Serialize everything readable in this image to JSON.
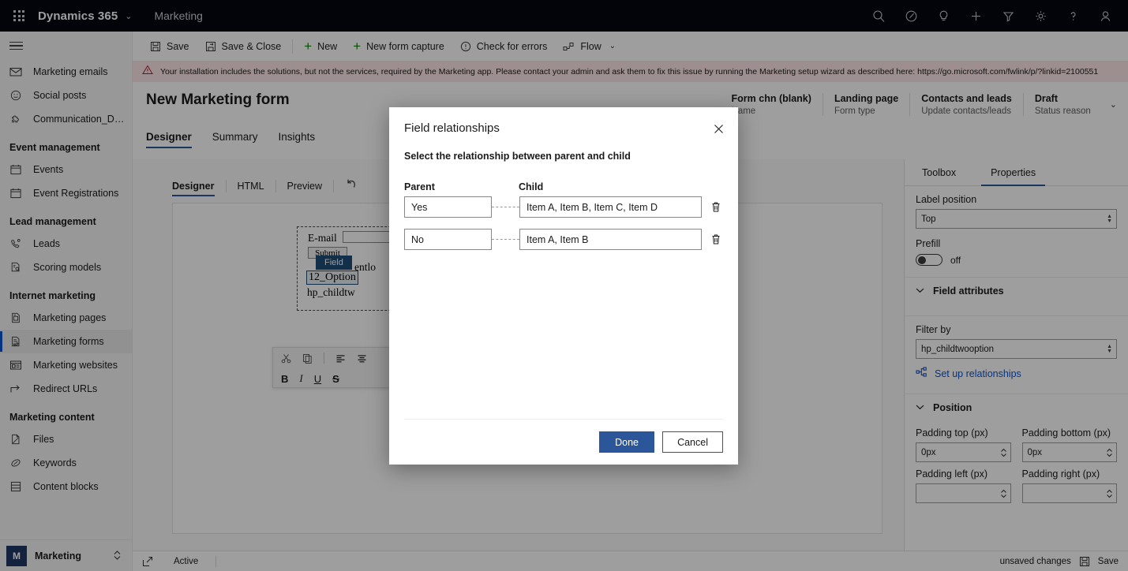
{
  "topnav": {
    "waffle": "app-launcher",
    "brand": "Dynamics 365",
    "brand_chevron": "⌄",
    "app_name": "Marketing",
    "icons": [
      {
        "name": "search-icon",
        "title": "Search"
      },
      {
        "name": "diagnostics-icon",
        "title": "Diagnostics"
      },
      {
        "name": "lightbulb-icon",
        "title": "Tips"
      },
      {
        "name": "plus-icon",
        "title": "New"
      },
      {
        "name": "filter-icon",
        "title": "Filter"
      },
      {
        "name": "gear-icon",
        "title": "Settings"
      },
      {
        "name": "help-icon",
        "title": "Help"
      },
      {
        "name": "account-icon",
        "title": "Account"
      }
    ]
  },
  "sidebar": {
    "hamburger": "menu-icon",
    "items": [
      {
        "label": "Marketing emails",
        "icon": "envelope-icon",
        "type": "item",
        "selected": false
      },
      {
        "label": "Social posts",
        "icon": "smiley-icon",
        "type": "item",
        "selected": false
      },
      {
        "label": "Communication_Det...",
        "icon": "puzzle-icon",
        "type": "item",
        "selected": false
      },
      {
        "label": "Event management",
        "type": "group"
      },
      {
        "label": "Events",
        "icon": "calendar-icon",
        "type": "item",
        "selected": false
      },
      {
        "label": "Event Registrations",
        "icon": "calendar-icon",
        "type": "item",
        "selected": false
      },
      {
        "label": "Lead management",
        "type": "group"
      },
      {
        "label": "Leads",
        "icon": "lead-icon",
        "type": "item",
        "selected": false
      },
      {
        "label": "Scoring models",
        "icon": "scoring-icon",
        "type": "item",
        "selected": false
      },
      {
        "label": "Internet marketing",
        "type": "group"
      },
      {
        "label": "Marketing pages",
        "icon": "page-icon",
        "type": "item",
        "selected": false
      },
      {
        "label": "Marketing forms",
        "icon": "form-icon",
        "type": "item",
        "selected": true
      },
      {
        "label": "Marketing websites",
        "icon": "website-icon",
        "type": "item",
        "selected": false
      },
      {
        "label": "Redirect URLs",
        "icon": "redirect-icon",
        "type": "item",
        "selected": false
      },
      {
        "label": "Marketing content",
        "type": "group"
      },
      {
        "label": "Files",
        "icon": "files-icon",
        "type": "item",
        "selected": false
      },
      {
        "label": "Keywords",
        "icon": "keywords-icon",
        "type": "item",
        "selected": false
      },
      {
        "label": "Content blocks",
        "icon": "content-blocks-icon",
        "type": "item",
        "selected": false
      }
    ],
    "footer": {
      "avatar_initial": "M",
      "label": "Marketing",
      "chevron": "selector"
    }
  },
  "commandbar": {
    "save": "Save",
    "save_close": "Save & Close",
    "new": "New",
    "new_form_capture": "New form capture",
    "check_errors": "Check for errors",
    "flow": "Flow",
    "flow_chevron": "⌄"
  },
  "warning": {
    "icon": "warning-icon",
    "text": "Your installation includes the solutions, but not the services, required by the Marketing app. Please contact your admin and ask them to fix this issue by running the Marketing setup wizard as described here: https://go.microsoft.com/fwlink/p/?linkid=2100551",
    "background": "#fde7e9"
  },
  "page": {
    "title": "New Marketing form",
    "tabs": [
      {
        "label": "Designer",
        "active": true
      },
      {
        "label": "Summary",
        "active": false
      },
      {
        "label": "Insights",
        "active": false
      }
    ],
    "header_fields": [
      {
        "value": "Form chn (blank)",
        "label": "Name"
      },
      {
        "value": "Landing page",
        "label": "Form type"
      },
      {
        "value": "Contacts and leads",
        "label": "Update contacts/leads"
      },
      {
        "value": "Draft",
        "label": "Status reason"
      }
    ],
    "header_chevron": "⌄"
  },
  "designer": {
    "subtabs": [
      {
        "label": "Designer",
        "active": true
      },
      {
        "label": "HTML",
        "active": false
      },
      {
        "label": "Preview",
        "active": false
      }
    ],
    "undo_icon": "undo-icon",
    "form_preview": {
      "email_label": "E-mail",
      "submit_label": "Submit",
      "field_badge": "Field",
      "parent_text": "entlo",
      "option_text": "12_Option",
      "child_text": "hp_childtw"
    },
    "float_toolbar": {
      "cut": "cut-icon",
      "copy": "copy-icon",
      "align_left": "align-left-icon",
      "align_center": "align-center-icon",
      "bold": "B",
      "italic": "I",
      "underline": "U",
      "strikethrough": "S"
    }
  },
  "properties": {
    "tabs": [
      {
        "label": "Toolbox",
        "active": false
      },
      {
        "label": "Properties",
        "active": true
      }
    ],
    "label_position": {
      "label": "Label position",
      "value": "Top"
    },
    "prefill": {
      "label": "Prefill",
      "state": "off"
    },
    "field_attributes": {
      "section_title": "Field attributes",
      "filter_by_label": "Filter by",
      "filter_by_value": "hp_childtwooption",
      "setup_link": "Set up relationships",
      "setup_link_icon": "relationships-icon",
      "link_color": "#0b53ce"
    },
    "position": {
      "section_title": "Position",
      "padding_top_label": "Padding top (px)",
      "padding_top_value": "0px",
      "padding_bottom_label": "Padding bottom (px)",
      "padding_bottom_value": "0px",
      "padding_left_label": "Padding left (px)",
      "padding_right_label": "Padding right (px)"
    }
  },
  "statusbar": {
    "expand_icon": "popout-icon",
    "status": "Active",
    "unsaved": "unsaved changes",
    "save_icon": "save-icon",
    "save_label": "Save"
  },
  "modal": {
    "title": "Field relationships",
    "close_icon": "close-icon",
    "subtitle": "Select the relationship between parent and child",
    "parent_header": "Parent",
    "child_header": "Child",
    "rows": [
      {
        "parent": "Yes",
        "child": "Item A, Item B, Item C, Item D",
        "delete_icon": "trash-icon"
      },
      {
        "parent": "No",
        "child": "Item A, Item B",
        "delete_icon": "trash-icon"
      }
    ],
    "done_label": "Done",
    "cancel_label": "Cancel",
    "primary_color": "#2b579a"
  }
}
